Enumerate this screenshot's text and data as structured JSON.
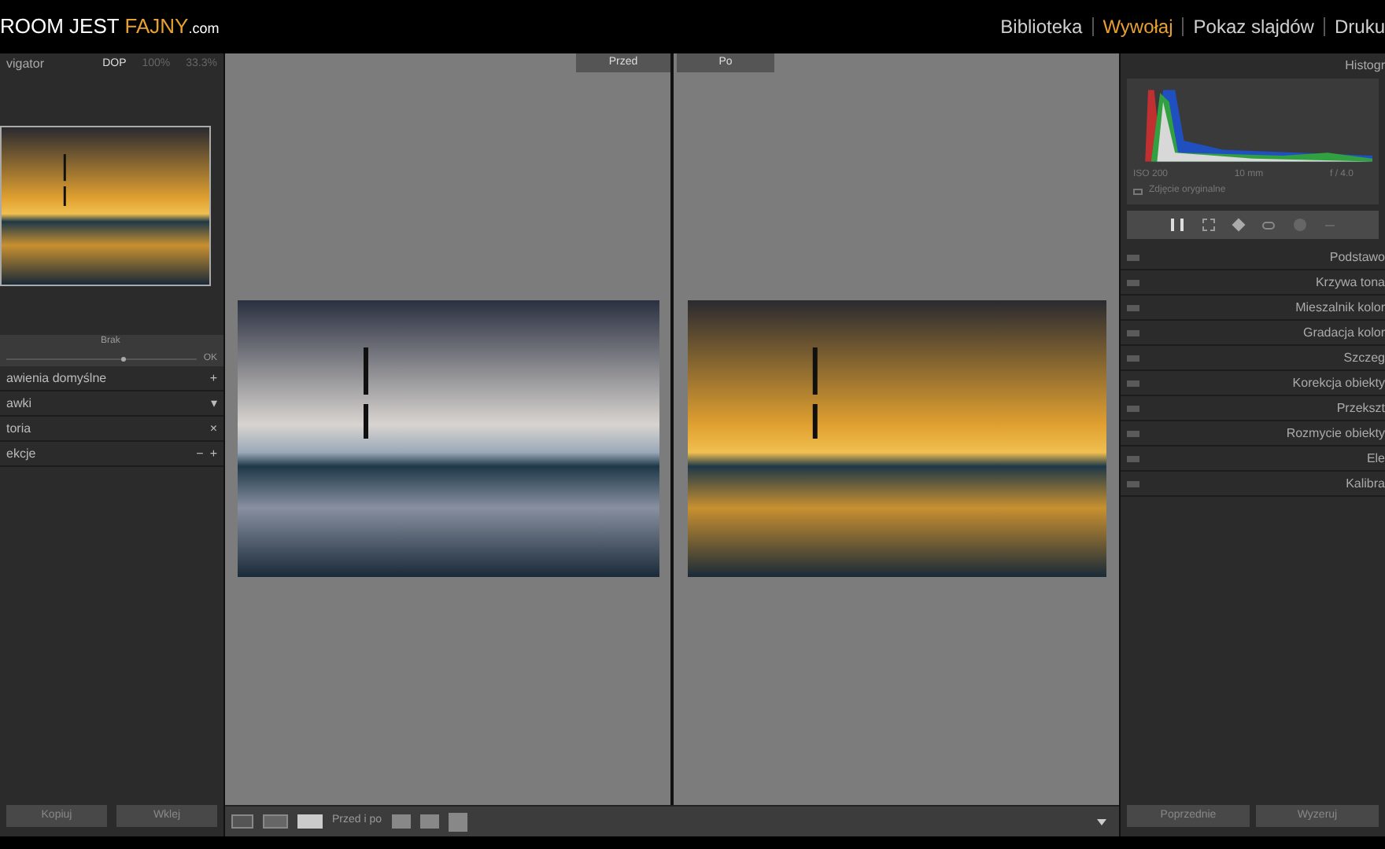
{
  "logo": {
    "part_1": "ROOM JEST ",
    "part_2": "FAJNY",
    "part_3": ".com"
  },
  "modules": [
    {
      "label": "Biblioteka",
      "selected": false
    },
    {
      "label": "Wywołaj",
      "selected": true
    },
    {
      "label": "Pokaz slajdów",
      "selected": false
    },
    {
      "label": "Druku",
      "selected": false
    }
  ],
  "navigator": {
    "title": "vigator",
    "zoom_options": [
      {
        "label": "DOP",
        "selected": true
      },
      {
        "label": "100%",
        "selected": false
      },
      {
        "label": "33.3%",
        "selected": false
      }
    ]
  },
  "preset_amount": {
    "label": "Brak",
    "value_label": "OK",
    "level": 0.6
  },
  "left_panels": [
    {
      "label": "awienia domyślne",
      "controls": [
        "+"
      ]
    },
    {
      "label": "awki",
      "controls": [
        "▾"
      ]
    },
    {
      "label": "toria",
      "controls": [
        "×"
      ]
    },
    {
      "label": "ekcje",
      "controls": [
        "−",
        "+"
      ]
    }
  ],
  "left_buttons": [
    "Kopiuj",
    "Wklej"
  ],
  "compare": {
    "before_label": "Przed",
    "after_label": "Po"
  },
  "toolbar": {
    "mode_label": "Przed i po"
  },
  "histogram": {
    "title": "Histogr",
    "info": [
      "ISO 200",
      "10 mm",
      "f / 4.0"
    ],
    "original_label": "Zdjęcie oryginalne"
  },
  "right_panels": [
    "Podstawo",
    "Krzywa tona",
    "Mieszalnik kolor",
    "Gradacja kolor",
    "Szczeg",
    "Korekcja obiekty",
    "Przekszt",
    "Rozmycie obiekty",
    "Ele",
    "Kalibra"
  ],
  "right_buttons": [
    "Poprzednie",
    "Wyzeruj"
  ]
}
